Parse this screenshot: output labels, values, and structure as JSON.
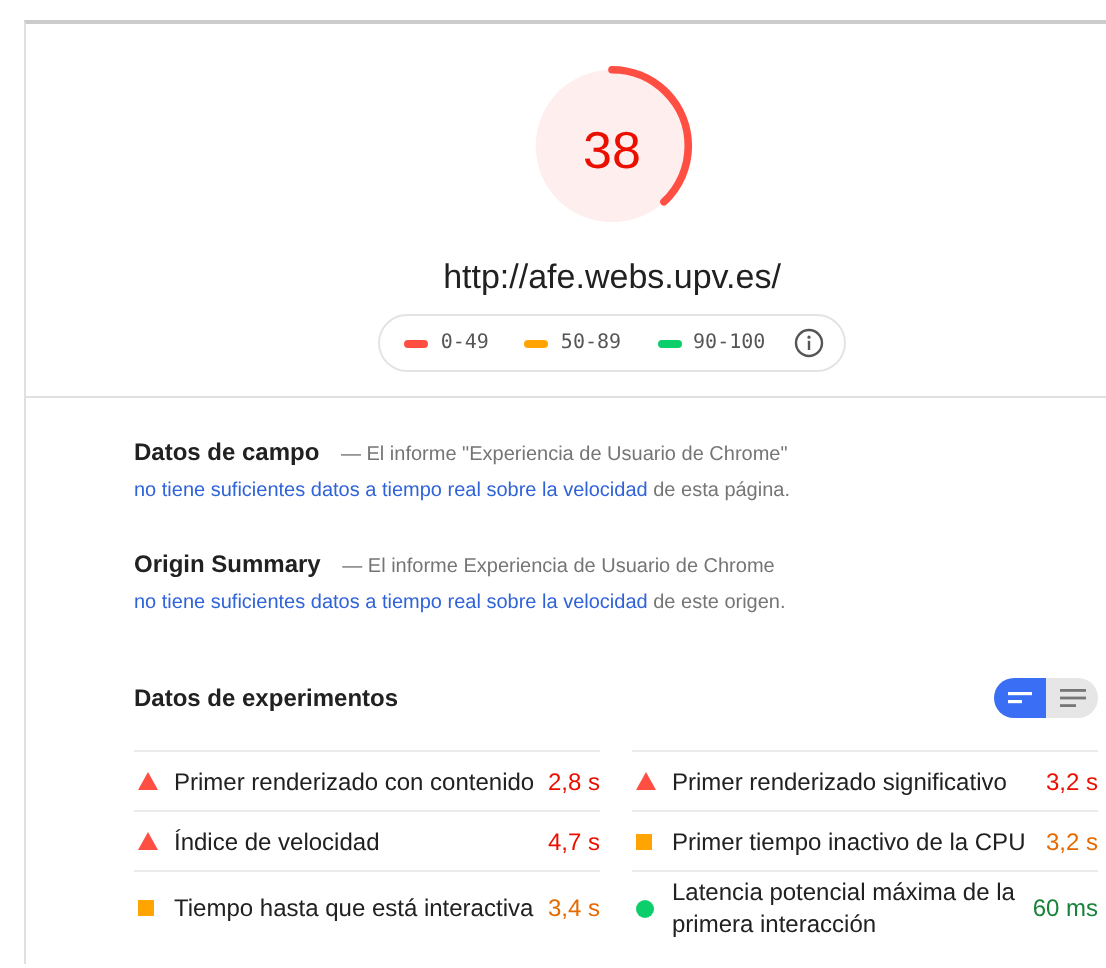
{
  "gauge": {
    "score": "38"
  },
  "url": "http://afe.webs.upv.es/",
  "legend": [
    {
      "label": "0-49",
      "color": "#ff4e42"
    },
    {
      "label": "50-89",
      "color": "#ffa400"
    },
    {
      "label": "90-100",
      "color": "#0cce6b"
    }
  ],
  "sections": [
    {
      "title": "Datos de campo",
      "text": "— El informe \"Experiencia de Usuario de Chrome\" ",
      "link": "no tiene suficientes datos a tiempo real sobre la velocidad",
      "after": " de esta página."
    },
    {
      "title": "Origin Summary",
      "text": "— El informe Experiencia de Usuario de Chrome ",
      "link": "no tiene suficientes datos a tiempo real sobre la velocidad",
      "after": " de este origen."
    }
  ],
  "lab": {
    "title": "Datos de experimentos",
    "view_toggle": [
      {
        "kind": "compact",
        "selected": true
      },
      {
        "kind": "list",
        "selected": false
      }
    ],
    "metrics": [
      {
        "name": "Primer renderizado con contenido",
        "value": "2,8 s",
        "kind": "fail"
      },
      {
        "name": "Índice de velocidad",
        "value": "4,7 s",
        "kind": "fail"
      },
      {
        "name": "Tiempo hasta que está interactiva",
        "value": "3,4 s",
        "kind": "average"
      },
      {
        "name": "Primer renderizado significativo",
        "value": "3,2 s",
        "kind": "fail"
      },
      {
        "name": "Primer tiempo inactivo de la CPU",
        "value": "3,2 s",
        "kind": "average"
      },
      {
        "name": "Latencia potencial máxima de la primera interacción",
        "value": "60 ms",
        "kind": "pass"
      }
    ]
  }
}
